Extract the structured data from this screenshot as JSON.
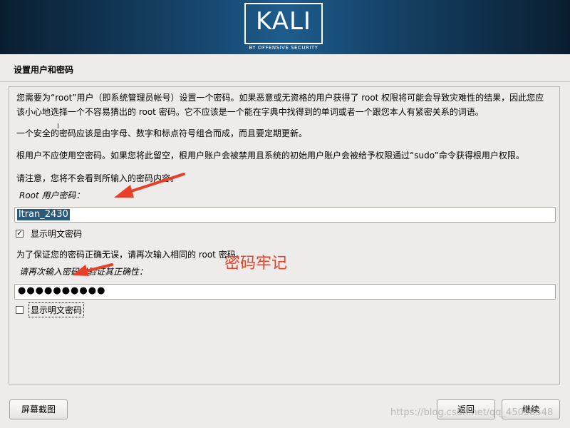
{
  "brand": {
    "logo": "KALI",
    "tagline": "BY OFFENSIVE SECURITY"
  },
  "page_title": "设置用户和密码",
  "paragraphs": {
    "p1_line1": "您需要为“root”用户（即系统管理员帐号）设置一个密码。如果恶意或无资格的用户获得了 root 权限将可能会导致灾难性的结果，因此您应",
    "p1_line2": "该小心地选择一个不容易猜出的 root 密码。它不应该是一个能在字典中找得到的单词或者一个跟您本人有紧密关系的词语。",
    "p2": "一个安全的密码应该是由字母、数字和标点符号组合而成，而且要定期更新。",
    "p3": "根用户不应使用空密码。如果您将此留空，根用户账户会被禁用且系统的初始用户账户会被给予权限通过“sudo”命令获得根用户权限。",
    "p4": "请注意，您将不会看到所输入的密码内容。",
    "p5": "为了保证您的密码正确无误，请再次输入相同的 root 密码。"
  },
  "password_field": {
    "label": "Root 用户密码：",
    "value": "ltran_2430"
  },
  "show_password_1": {
    "label": "显示明文密码",
    "checked": true,
    "mark": "✓"
  },
  "confirm_field": {
    "label": "请再次输入密码以验证其正确性：",
    "value": "●●●●●●●●●●"
  },
  "show_password_2": {
    "label": "显示明文密码",
    "checked": false,
    "mark": ""
  },
  "buttons": {
    "screenshot": "屏幕截图",
    "back": "返回",
    "continue": "继续"
  },
  "annotation": "密码牢记",
  "watermark": "https://blog.csdn.net/qq_45058548",
  "colors": {
    "annotation_red": "#e8412a",
    "selection_blue": "#2c5a7a",
    "banner_blue": "#1d5d8d"
  }
}
